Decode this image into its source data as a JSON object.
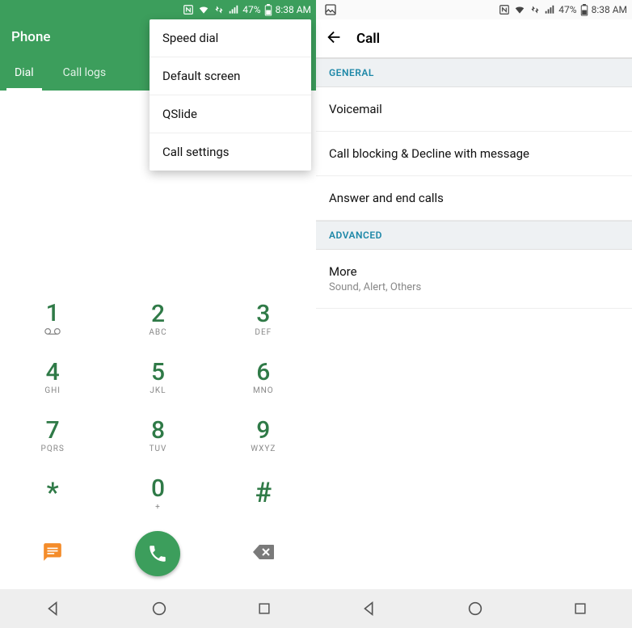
{
  "statusbar": {
    "battery_pct": "47%",
    "time": "8:38 AM"
  },
  "left": {
    "app_title": "Phone",
    "tabs": [
      "Dial",
      "Call logs"
    ],
    "menu": [
      "Speed dial",
      "Default screen",
      "QSlide",
      "Call settings"
    ],
    "keys": [
      {
        "digit": "1",
        "letters": "∞"
      },
      {
        "digit": "2",
        "letters": "ABC"
      },
      {
        "digit": "3",
        "letters": "DEF"
      },
      {
        "digit": "4",
        "letters": "GHI"
      },
      {
        "digit": "5",
        "letters": "JKL"
      },
      {
        "digit": "6",
        "letters": "MNO"
      },
      {
        "digit": "7",
        "letters": "PQRS"
      },
      {
        "digit": "8",
        "letters": "TUV"
      },
      {
        "digit": "9",
        "letters": "WXYZ"
      },
      {
        "digit": "*",
        "letters": ""
      },
      {
        "digit": "0",
        "letters": "+"
      },
      {
        "digit": "#",
        "letters": ""
      }
    ]
  },
  "right": {
    "title": "Call",
    "section_general": "GENERAL",
    "items_general": [
      "Voicemail",
      "Call blocking & Decline with message",
      "Answer and end calls"
    ],
    "section_advanced": "ADVANCED",
    "more_title": "More",
    "more_sub": "Sound, Alert, Others"
  }
}
